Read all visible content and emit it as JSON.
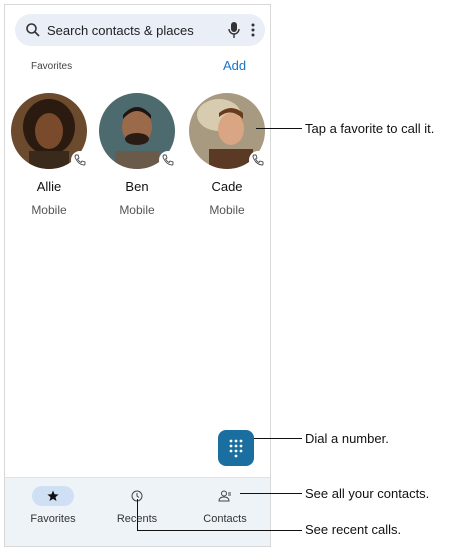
{
  "search": {
    "placeholder": "Search contacts & places"
  },
  "favorites": {
    "label": "Favorites",
    "add_label": "Add",
    "items": [
      {
        "name": "Allie",
        "type": "Mobile"
      },
      {
        "name": "Ben",
        "type": "Mobile"
      },
      {
        "name": "Cade",
        "type": "Mobile"
      }
    ]
  },
  "nav": {
    "items": [
      {
        "label": "Favorites",
        "icon": "star-icon",
        "active": true
      },
      {
        "label": "Recents",
        "icon": "clock-icon",
        "active": false
      },
      {
        "label": "Contacts",
        "icon": "contacts-icon",
        "active": false
      }
    ]
  },
  "callouts": {
    "favorite": "Tap a favorite to call it.",
    "dial": "Dial a number.",
    "contacts": "See all your contacts.",
    "recents": "See recent calls."
  },
  "colors": {
    "accent": "#1a73c8",
    "fab": "#1a6fa0",
    "nav_bg": "#eef3f8",
    "active_pill": "#cfe0f5"
  }
}
